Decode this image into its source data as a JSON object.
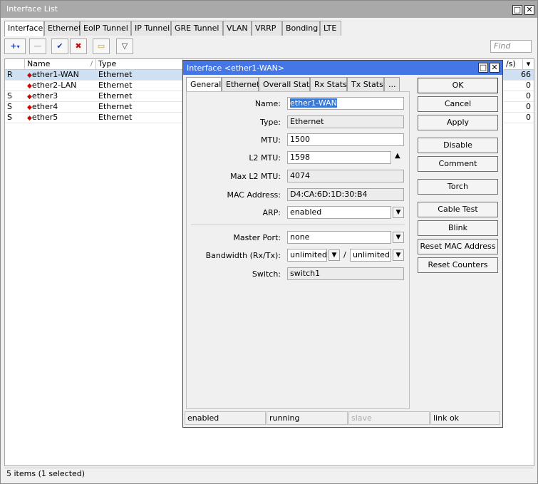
{
  "window": {
    "title": "Interface List"
  },
  "tabs": [
    "Interface",
    "Ethernet",
    "EoIP Tunnel",
    "IP Tunnel",
    "GRE Tunnel",
    "VLAN",
    "VRRP",
    "Bonding",
    "LTE"
  ],
  "toolbar": {
    "add": "+",
    "remove": "—",
    "enable": "✔",
    "disable": "✖",
    "comment": "▭",
    "filter": "▽"
  },
  "find": {
    "placeholder": "Find"
  },
  "grid": {
    "headers": {
      "flag": "",
      "name": "Name",
      "type": "Type",
      "rate_tail": "/s)",
      "sort_mark": "/"
    },
    "rows": [
      {
        "flag": "R",
        "name": "ether1-WAN",
        "type": "Ethernet",
        "last": "66"
      },
      {
        "flag": "",
        "name": "ether2-LAN",
        "type": "Ethernet",
        "last": "0"
      },
      {
        "flag": "S",
        "name": "ether3",
        "type": "Ethernet",
        "last": "0"
      },
      {
        "flag": "S",
        "name": "ether4",
        "type": "Ethernet",
        "last": "0"
      },
      {
        "flag": "S",
        "name": "ether5",
        "type": "Ethernet",
        "last": "0"
      }
    ]
  },
  "status": "5 items (1 selected)",
  "dialog": {
    "title": "Interface <ether1-WAN>",
    "tabs": [
      "General",
      "Ethernet",
      "Overall Stats",
      "Rx Stats",
      "Tx Stats",
      "..."
    ],
    "fields": {
      "name": {
        "label": "Name:",
        "value": "ether1-WAN"
      },
      "type": {
        "label": "Type:",
        "value": "Ethernet"
      },
      "mtu": {
        "label": "MTU:",
        "value": "1500"
      },
      "l2mtu": {
        "label": "L2 MTU:",
        "value": "1598"
      },
      "maxl2mtu": {
        "label": "Max L2 MTU:",
        "value": "4074"
      },
      "mac": {
        "label": "MAC Address:",
        "value": "D4:CA:6D:1D:30:B4"
      },
      "arp": {
        "label": "ARP:",
        "value": "enabled"
      },
      "master": {
        "label": "Master Port:",
        "value": "none"
      },
      "bandwidth": {
        "label": "Bandwidth (Rx/Tx):",
        "rx": "unlimited",
        "sep": "/",
        "tx": "unlimited"
      },
      "switch": {
        "label": "Switch:",
        "value": "switch1"
      }
    },
    "buttons": [
      "OK",
      "Cancel",
      "Apply",
      "Disable",
      "Comment",
      "Torch",
      "Cable Test",
      "Blink",
      "Reset MAC Address",
      "Reset Counters"
    ],
    "statusbar": [
      "enabled",
      "running",
      "slave",
      "link ok"
    ]
  }
}
